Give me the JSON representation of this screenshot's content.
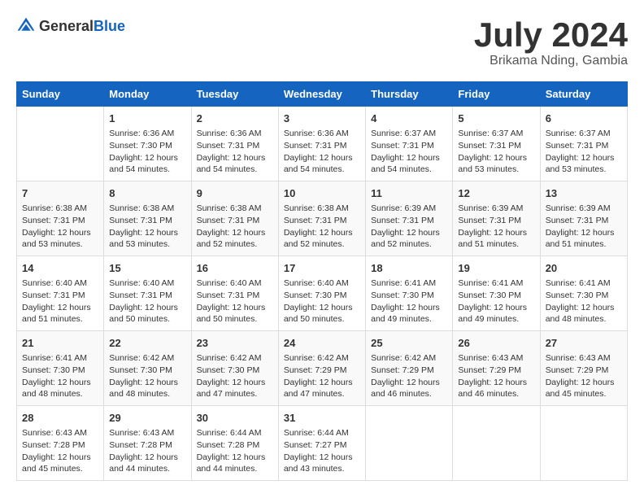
{
  "header": {
    "logo_general": "General",
    "logo_blue": "Blue",
    "title": "July 2024",
    "location": "Brikama Nding, Gambia"
  },
  "days_of_week": [
    "Sunday",
    "Monday",
    "Tuesday",
    "Wednesday",
    "Thursday",
    "Friday",
    "Saturday"
  ],
  "weeks": [
    [
      {
        "day": "",
        "info": ""
      },
      {
        "day": "1",
        "info": "Sunrise: 6:36 AM\nSunset: 7:30 PM\nDaylight: 12 hours\nand 54 minutes."
      },
      {
        "day": "2",
        "info": "Sunrise: 6:36 AM\nSunset: 7:31 PM\nDaylight: 12 hours\nand 54 minutes."
      },
      {
        "day": "3",
        "info": "Sunrise: 6:36 AM\nSunset: 7:31 PM\nDaylight: 12 hours\nand 54 minutes."
      },
      {
        "day": "4",
        "info": "Sunrise: 6:37 AM\nSunset: 7:31 PM\nDaylight: 12 hours\nand 54 minutes."
      },
      {
        "day": "5",
        "info": "Sunrise: 6:37 AM\nSunset: 7:31 PM\nDaylight: 12 hours\nand 53 minutes."
      },
      {
        "day": "6",
        "info": "Sunrise: 6:37 AM\nSunset: 7:31 PM\nDaylight: 12 hours\nand 53 minutes."
      }
    ],
    [
      {
        "day": "7",
        "info": "Sunrise: 6:38 AM\nSunset: 7:31 PM\nDaylight: 12 hours\nand 53 minutes."
      },
      {
        "day": "8",
        "info": "Sunrise: 6:38 AM\nSunset: 7:31 PM\nDaylight: 12 hours\nand 53 minutes."
      },
      {
        "day": "9",
        "info": "Sunrise: 6:38 AM\nSunset: 7:31 PM\nDaylight: 12 hours\nand 52 minutes."
      },
      {
        "day": "10",
        "info": "Sunrise: 6:38 AM\nSunset: 7:31 PM\nDaylight: 12 hours\nand 52 minutes."
      },
      {
        "day": "11",
        "info": "Sunrise: 6:39 AM\nSunset: 7:31 PM\nDaylight: 12 hours\nand 52 minutes."
      },
      {
        "day": "12",
        "info": "Sunrise: 6:39 AM\nSunset: 7:31 PM\nDaylight: 12 hours\nand 51 minutes."
      },
      {
        "day": "13",
        "info": "Sunrise: 6:39 AM\nSunset: 7:31 PM\nDaylight: 12 hours\nand 51 minutes."
      }
    ],
    [
      {
        "day": "14",
        "info": "Sunrise: 6:40 AM\nSunset: 7:31 PM\nDaylight: 12 hours\nand 51 minutes."
      },
      {
        "day": "15",
        "info": "Sunrise: 6:40 AM\nSunset: 7:31 PM\nDaylight: 12 hours\nand 50 minutes."
      },
      {
        "day": "16",
        "info": "Sunrise: 6:40 AM\nSunset: 7:31 PM\nDaylight: 12 hours\nand 50 minutes."
      },
      {
        "day": "17",
        "info": "Sunrise: 6:40 AM\nSunset: 7:30 PM\nDaylight: 12 hours\nand 50 minutes."
      },
      {
        "day": "18",
        "info": "Sunrise: 6:41 AM\nSunset: 7:30 PM\nDaylight: 12 hours\nand 49 minutes."
      },
      {
        "day": "19",
        "info": "Sunrise: 6:41 AM\nSunset: 7:30 PM\nDaylight: 12 hours\nand 49 minutes."
      },
      {
        "day": "20",
        "info": "Sunrise: 6:41 AM\nSunset: 7:30 PM\nDaylight: 12 hours\nand 48 minutes."
      }
    ],
    [
      {
        "day": "21",
        "info": "Sunrise: 6:41 AM\nSunset: 7:30 PM\nDaylight: 12 hours\nand 48 minutes."
      },
      {
        "day": "22",
        "info": "Sunrise: 6:42 AM\nSunset: 7:30 PM\nDaylight: 12 hours\nand 48 minutes."
      },
      {
        "day": "23",
        "info": "Sunrise: 6:42 AM\nSunset: 7:30 PM\nDaylight: 12 hours\nand 47 minutes."
      },
      {
        "day": "24",
        "info": "Sunrise: 6:42 AM\nSunset: 7:29 PM\nDaylight: 12 hours\nand 47 minutes."
      },
      {
        "day": "25",
        "info": "Sunrise: 6:42 AM\nSunset: 7:29 PM\nDaylight: 12 hours\nand 46 minutes."
      },
      {
        "day": "26",
        "info": "Sunrise: 6:43 AM\nSunset: 7:29 PM\nDaylight: 12 hours\nand 46 minutes."
      },
      {
        "day": "27",
        "info": "Sunrise: 6:43 AM\nSunset: 7:29 PM\nDaylight: 12 hours\nand 45 minutes."
      }
    ],
    [
      {
        "day": "28",
        "info": "Sunrise: 6:43 AM\nSunset: 7:28 PM\nDaylight: 12 hours\nand 45 minutes."
      },
      {
        "day": "29",
        "info": "Sunrise: 6:43 AM\nSunset: 7:28 PM\nDaylight: 12 hours\nand 44 minutes."
      },
      {
        "day": "30",
        "info": "Sunrise: 6:44 AM\nSunset: 7:28 PM\nDaylight: 12 hours\nand 44 minutes."
      },
      {
        "day": "31",
        "info": "Sunrise: 6:44 AM\nSunset: 7:27 PM\nDaylight: 12 hours\nand 43 minutes."
      },
      {
        "day": "",
        "info": ""
      },
      {
        "day": "",
        "info": ""
      },
      {
        "day": "",
        "info": ""
      }
    ]
  ]
}
